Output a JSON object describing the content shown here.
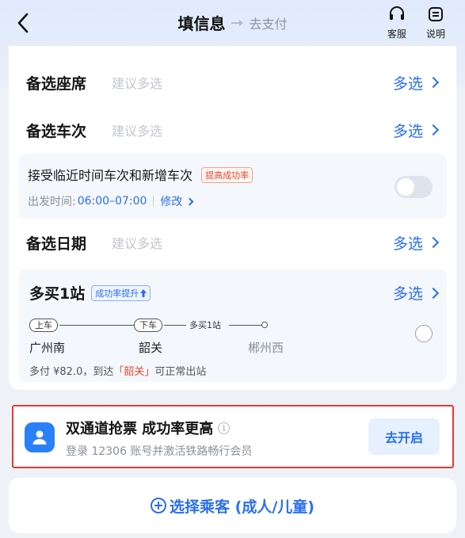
{
  "header": {
    "back_icon": "chevron-left-icon",
    "title": "填信息",
    "next_step": "去支付",
    "kefu_label": "客服",
    "kefu_icon": "headset-icon",
    "shuoming_label": "说明",
    "shuoming_icon": "document-icon"
  },
  "rows": {
    "seat": {
      "label": "备选座席",
      "placeholder": "建议多选",
      "action": "多选"
    },
    "train": {
      "label": "备选车次",
      "placeholder": "建议多选",
      "action": "多选"
    },
    "date": {
      "label": "备选日期",
      "placeholder": "建议多选",
      "action": "多选"
    }
  },
  "accept_nearby": {
    "title": "接受临近时间车次和新增车次",
    "badge": "提高成功率",
    "depart_label": "出发时间:",
    "depart_time": "06:00–07:00",
    "modify": "修改",
    "toggle_on": false
  },
  "buy_more": {
    "title": "多买1站",
    "badge": "成功率提升",
    "action": "多选",
    "route": {
      "board_tag": "上车",
      "alight_tag": "下车",
      "extra_tag": "多买1站",
      "board_station": "广州南",
      "alight_station": "韶关",
      "extra_station": "郴州西"
    },
    "note_prefix": "多付 ¥82.0，到达",
    "note_highlight": "「韶关」",
    "note_suffix": "可正常出站",
    "checked": false
  },
  "dual_channel": {
    "icon": "user-icon",
    "title": "双通道抢票 成功率更高",
    "info_icon": "info-icon",
    "subtitle": "登录 12306 账号并激活铁路畅行会员",
    "button": "去开启"
  },
  "passenger": {
    "icon": "plus-circle-icon",
    "label": "选择乘客 (成人/儿童)"
  },
  "colors": {
    "accent": "#2a6ff0",
    "highlight_red": "#e53935",
    "orange_text": "#e0482f"
  }
}
